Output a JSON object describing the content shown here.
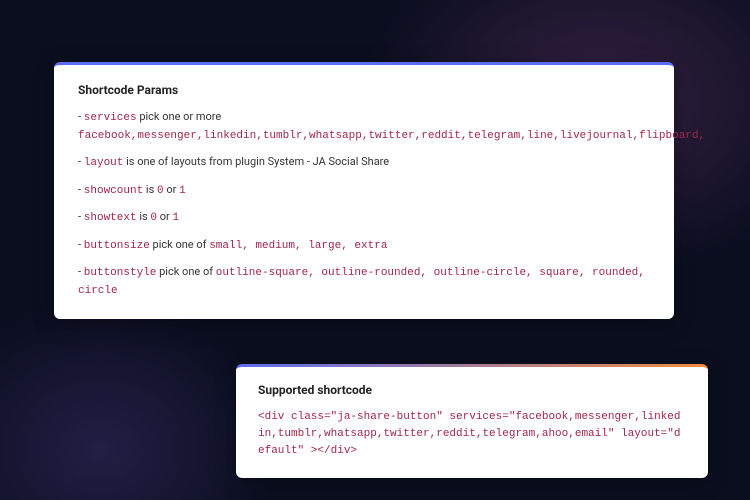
{
  "card1": {
    "heading": "Shortcode Params",
    "params": [
      {
        "bullet": "- ",
        "name": "services",
        "desc": " pick one or more",
        "extra": "facebook,messenger,linkedin,tumblr,whatsapp,twitter,reddit,telegram,line,livejournal,flipboard,"
      },
      {
        "bullet": "- ",
        "name": "layout",
        "desc": " is one of layouts from plugin System - JA Social Share",
        "extra": ""
      },
      {
        "bullet": "- ",
        "name": "showcount",
        "desc_parts": [
          " is ",
          "0",
          " or ",
          "1"
        ],
        "extra": ""
      },
      {
        "bullet": "- ",
        "name": "showtext",
        "desc_parts": [
          " is ",
          "0",
          " or ",
          "1"
        ],
        "extra": ""
      },
      {
        "bullet": "- ",
        "name": "buttonsize",
        "desc": " pick one of ",
        "extra_inline": "small, medium, large, extra"
      },
      {
        "bullet": "- ",
        "name": "buttonstyle",
        "desc": " pick one of ",
        "extra_inline": "outline-square, outline-rounded, outline-circle, square, rounded, circle"
      }
    ]
  },
  "card2": {
    "heading": "Supported shortcode",
    "code": "<div class=\"ja-share-button\" services=\"facebook,messenger,linkedin,tumblr,whatsapp,twitter,reddit,telegram,ahoo,email\" layout=\"default\" ></div>"
  }
}
